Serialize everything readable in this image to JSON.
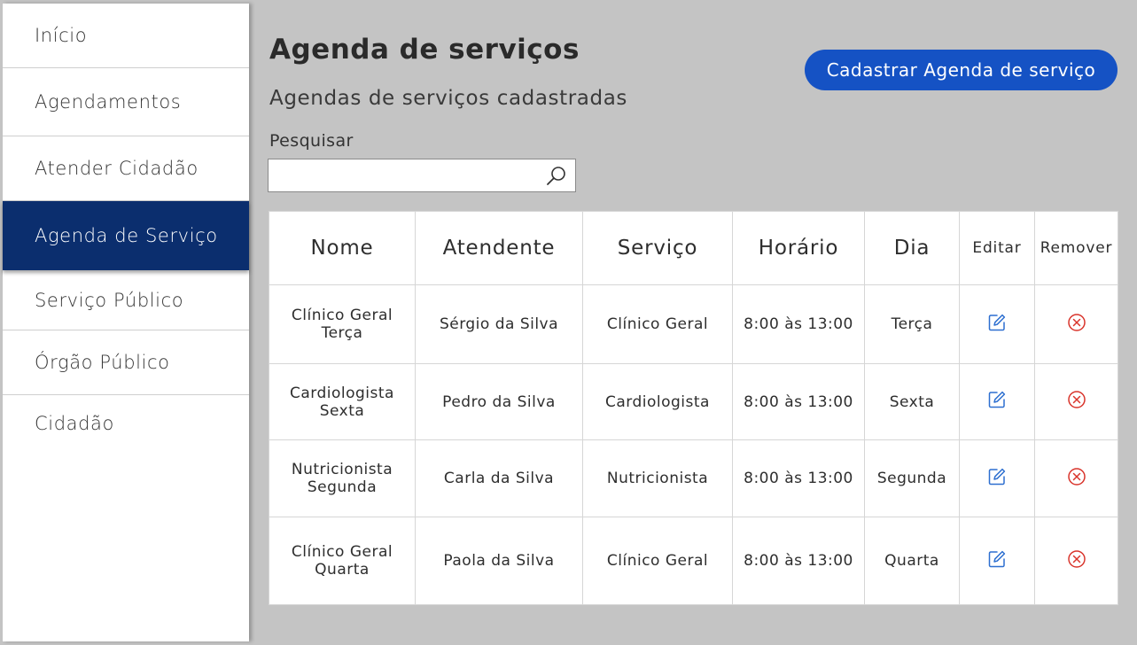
{
  "sidebar": {
    "items": [
      {
        "label": "Início"
      },
      {
        "label": "Agendamentos"
      },
      {
        "label": "Atender Cidadão"
      },
      {
        "label": "Agenda de Serviço"
      },
      {
        "label": "Serviço Público"
      },
      {
        "label": "Órgão Público"
      },
      {
        "label": "Cidadão"
      }
    ],
    "active_index": 3
  },
  "header": {
    "title": "Agenda de serviços",
    "subtitle": "Agendas de serviços cadastradas",
    "primary_button": "Cadastrar Agenda de serviço"
  },
  "search": {
    "label": "Pesquisar",
    "value": "",
    "placeholder": ""
  },
  "table": {
    "columns": [
      "Nome",
      "Atendente",
      "Serviço",
      "Horário",
      "Dia",
      "Editar",
      "Remover"
    ],
    "rows": [
      {
        "nome_1": "Clínico Geral",
        "nome_2": "Terça",
        "atendente": "Sérgio da Silva",
        "servico": "Clínico Geral",
        "horario": "8:00 às 13:00",
        "dia": "Terça"
      },
      {
        "nome_1": "Cardiologista",
        "nome_2": "Sexta",
        "atendente": "Pedro da Silva",
        "servico": "Cardiologista",
        "horario": "8:00 às 13:00",
        "dia": "Sexta"
      },
      {
        "nome_1": "Nutricionista",
        "nome_2": "Segunda",
        "atendente": "Carla da Silva",
        "servico": "Nutricionista",
        "horario": "8:00 às 13:00",
        "dia": "Segunda"
      },
      {
        "nome_1": "Clínico Geral",
        "nome_2": "Quarta",
        "atendente": "Paola da Silva",
        "servico": "Clínico Geral",
        "horario": "8:00 às 13:00",
        "dia": "Quarta"
      }
    ]
  },
  "icons": {
    "search": "search-icon",
    "edit": "edit-icon",
    "remove": "remove-icon"
  },
  "colors": {
    "sidebar_active": "#0b2e6e",
    "primary_button": "#1552c4",
    "background": "#c4c4c4",
    "edit_icon": "#2d6fd0",
    "remove_icon": "#d9342b"
  }
}
